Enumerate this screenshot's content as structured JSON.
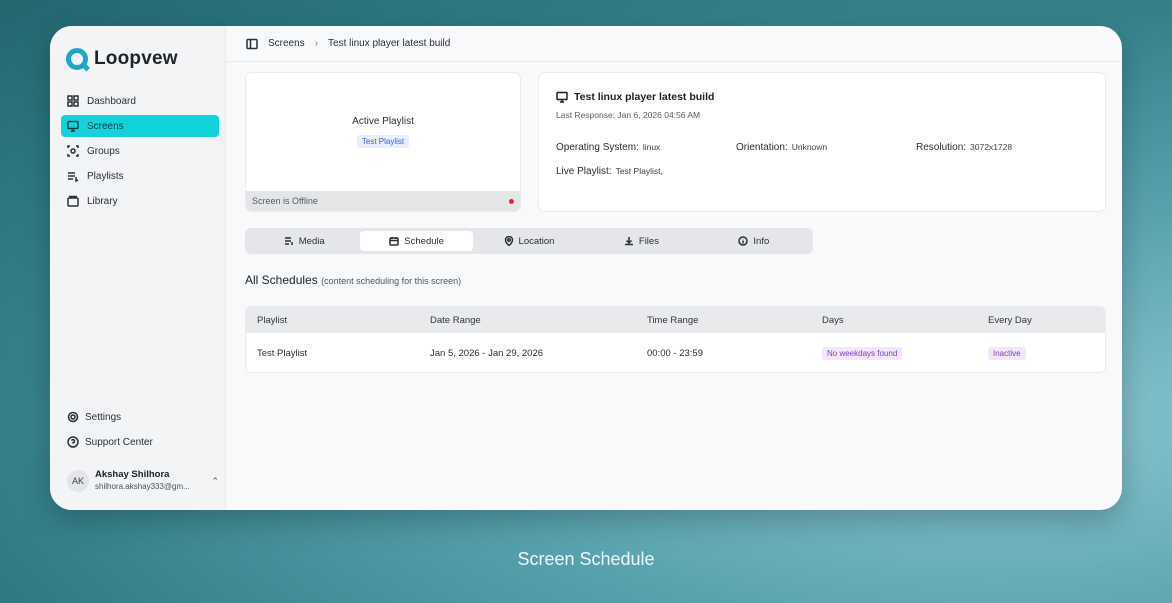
{
  "brand": {
    "name": "Loopvew"
  },
  "sidebar": {
    "items": [
      {
        "label": "Dashboard",
        "icon": "dashboard-icon"
      },
      {
        "label": "Screens",
        "icon": "monitor-icon",
        "active": true
      },
      {
        "label": "Groups",
        "icon": "groups-icon"
      },
      {
        "label": "Playlists",
        "icon": "playlist-icon"
      },
      {
        "label": "Library",
        "icon": "library-icon"
      }
    ],
    "bottom": [
      {
        "label": "Settings",
        "icon": "gear-icon"
      },
      {
        "label": "Support Center",
        "icon": "help-icon"
      }
    ],
    "user": {
      "initials": "AK",
      "name": "Akshay Shilhora",
      "email": "shilhora.akshay333@gm..."
    }
  },
  "breadcrumb": {
    "root": "Screens",
    "current": "Test linux player latest build"
  },
  "preview": {
    "title": "Active Playlist",
    "playlist": "Test Playlist",
    "status": "Screen is Offline",
    "status_color": "#e5262a"
  },
  "screen": {
    "name": "Test linux player latest build",
    "last_response": "Last Response: Jan 6, 2026 04:56 AM",
    "os_label": "Operating System:",
    "os": "linux",
    "orientation_label": "Orientation:",
    "orientation": "Unknown",
    "resolution_label": "Resolution:",
    "resolution": "3072x1728",
    "live_label": "Live Playlist:",
    "live": "Test Playlist,"
  },
  "tabs": [
    {
      "label": "Media",
      "icon": "media-icon"
    },
    {
      "label": "Schedule",
      "icon": "calendar-icon",
      "active": true
    },
    {
      "label": "Location",
      "icon": "location-pin-icon"
    },
    {
      "label": "Files",
      "icon": "download-icon"
    },
    {
      "label": "Info",
      "icon": "info-icon"
    }
  ],
  "schedules": {
    "title": "All Schedules",
    "note": "(content scheduling for this screen)",
    "columns": [
      "Playlist",
      "Date Range",
      "Time Range",
      "Days",
      "Every Day"
    ],
    "rows": [
      {
        "playlist": "Test Playlist",
        "date_range": "Jan 5, 2026 - Jan 29, 2026",
        "time_range": "00:00 - 23:59",
        "days": "No weekdays found",
        "every_day": "Inactive"
      }
    ]
  },
  "caption": "Screen Schedule",
  "colors": {
    "accent": "#11d3db",
    "brand": "#1ea7c4"
  }
}
